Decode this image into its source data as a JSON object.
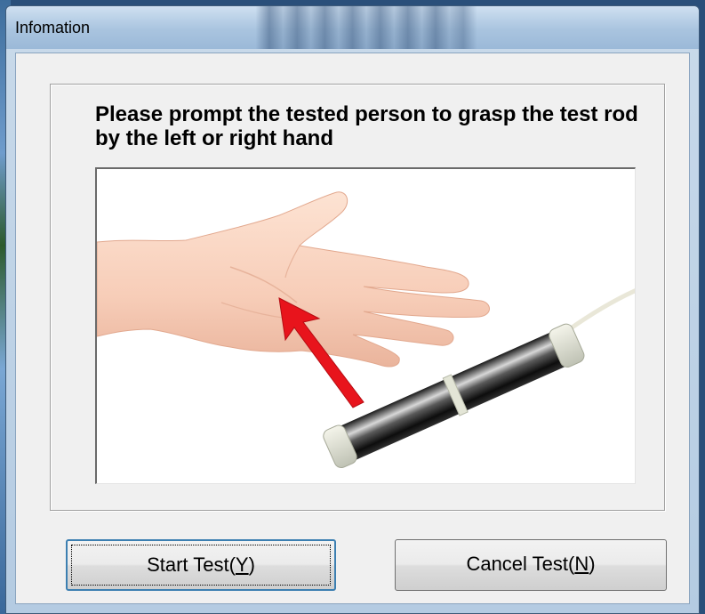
{
  "window": {
    "title": "Infomation"
  },
  "dialog": {
    "message": "Please prompt the tested person to grasp the test rod by the left or right hand",
    "image": {
      "depicts": [
        "hand-illustration",
        "arrow-icon",
        "test-rod"
      ],
      "arrow_color": "#e8141c"
    }
  },
  "buttons": {
    "start": {
      "label_prefix": "Start Test(",
      "mnemonic": "Y",
      "label_suffix": ")"
    },
    "cancel": {
      "label_prefix": "Cancel Test(",
      "mnemonic": "N",
      "label_suffix": ")"
    }
  },
  "colors": {
    "titlebar": "#a9c4df",
    "client": "#f0f0f0",
    "default_button_border": "#3c7fb1"
  }
}
